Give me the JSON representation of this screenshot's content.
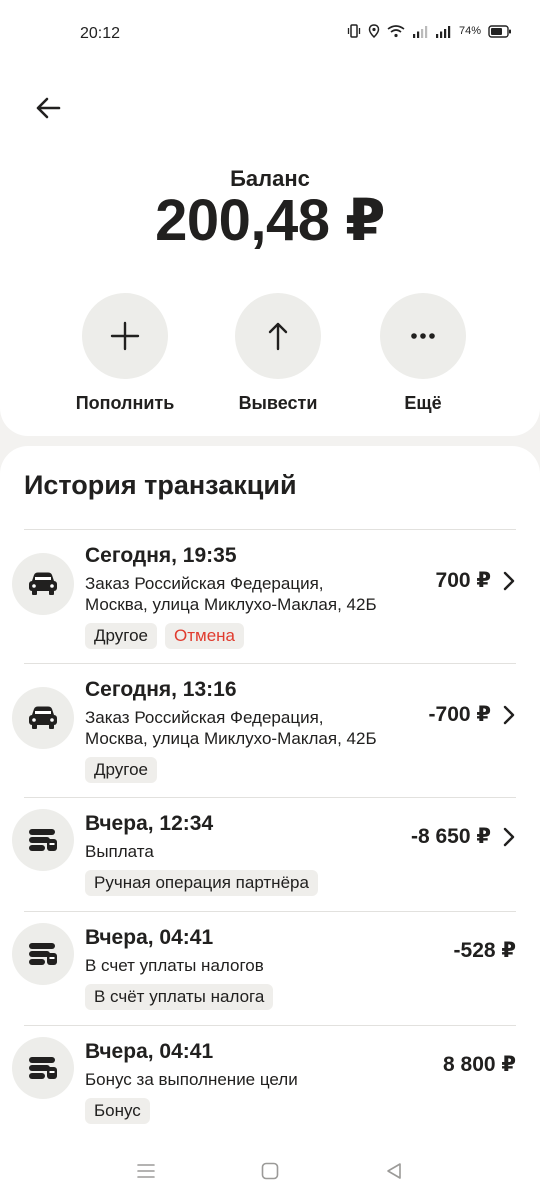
{
  "status_bar": {
    "time": "20:12",
    "battery": "74%"
  },
  "header": {
    "balance_label": "Баланс",
    "balance_amount": "200,48 ₽"
  },
  "actions": [
    {
      "label": "Пополнить",
      "icon": "plus-icon"
    },
    {
      "label": "Вывести",
      "icon": "arrow-up-icon"
    },
    {
      "label": "Ещё",
      "icon": "more-dots-icon"
    }
  ],
  "history": {
    "title": "История транзакций",
    "items": [
      {
        "icon": "taxi-icon",
        "title": "Сегодня, 19:35",
        "desc_line1": "Заказ Российская Федерация,",
        "desc_line2": "Москва, улица Миклухо-Маклая, 42Б",
        "tags": [
          "Другое",
          "Отмена"
        ],
        "amount": "700 ₽",
        "has_chevron": true
      },
      {
        "icon": "taxi-icon",
        "title": "Сегодня, 13:16",
        "desc_line1": "Заказ Российская Федерация,",
        "desc_line2": "Москва, улица Миклухо-Маклая, 42Б",
        "tags": [
          "Другое"
        ],
        "amount": "-700 ₽",
        "has_chevron": true
      },
      {
        "icon": "coins-icon",
        "title": "Вчера, 12:34",
        "desc_line1": "Выплата",
        "tags": [
          "Ручная операция партнёра"
        ],
        "amount": "-8 650 ₽",
        "has_chevron": true
      },
      {
        "icon": "coins-icon",
        "title": "Вчера, 04:41",
        "desc_line1": "В счет уплаты налогов",
        "tags": [
          "В счёт уплаты налога"
        ],
        "amount": "-528 ₽",
        "has_chevron": false
      },
      {
        "icon": "coins-icon",
        "title": "Вчера, 04:41",
        "desc_line1": "Бонус за выполнение цели",
        "tags": [
          "Бонус"
        ],
        "amount": "8 800 ₽",
        "has_chevron": false
      }
    ]
  },
  "colors": {
    "accent_red": "#e03b2e",
    "text": "#21201f",
    "chip_bg": "#efeeeb"
  }
}
